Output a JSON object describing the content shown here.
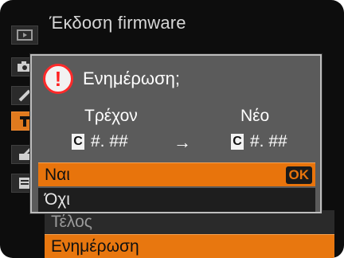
{
  "menu": {
    "title": "Έκδοση firmware",
    "items": [
      {
        "label": "Τέλος"
      },
      {
        "label": "Ενημέρωση"
      }
    ]
  },
  "tabs": [
    {
      "icon": "playback-icon"
    },
    {
      "icon": "camera-icon"
    },
    {
      "icon": "pencil-icon"
    },
    {
      "icon": "wrench-icon",
      "active": true
    },
    {
      "icon": "retouch-icon"
    },
    {
      "icon": "recent-settings-icon"
    }
  ],
  "dialog": {
    "title": "Ενημέρωση;",
    "alert_symbol": "!",
    "current_label": "Τρέχον",
    "new_label": "Νέο",
    "current_prefix": "C",
    "current_version": "#. ##",
    "new_prefix": "C",
    "new_version": "#. ##",
    "arrow": "→",
    "yes_label": "Ναι",
    "no_label": "Όχι",
    "ok_badge": "OK"
  },
  "colors": {
    "accent": "#e8740c",
    "alert": "#ff2a2a",
    "dialog_bg": "#5b5b5b"
  }
}
